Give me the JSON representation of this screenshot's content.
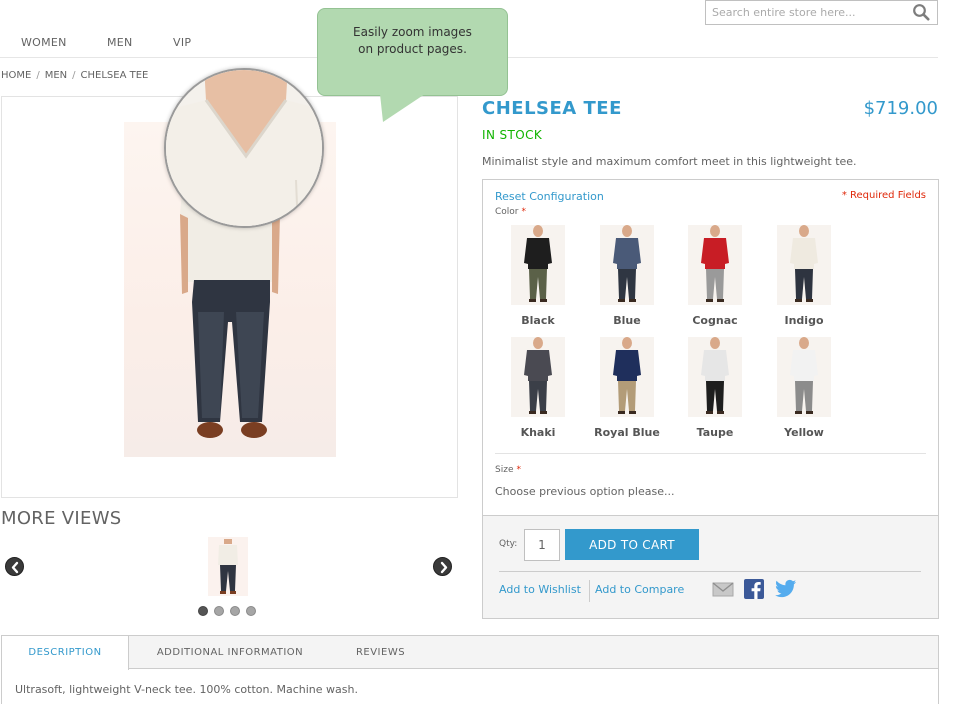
{
  "header": {
    "search_placeholder": "Search entire store here..."
  },
  "nav": {
    "items": [
      {
        "label": "WOMEN"
      },
      {
        "label": "MEN"
      },
      {
        "label": "VIP"
      }
    ]
  },
  "breadcrumb": {
    "items": [
      "HOME",
      "MEN",
      "CHELSEA TEE"
    ],
    "separator": "/"
  },
  "tooltip": {
    "text": "Easily zoom images on product pages."
  },
  "gallery": {
    "more_views_title": "MORE VIEWS",
    "dots_count": 4,
    "active_dot": 0
  },
  "product": {
    "name": "CHELSEA TEE",
    "price": "$719.00",
    "availability": "IN STOCK",
    "short_description": "Minimalist style and maximum comfort meet in this lightweight tee.",
    "reset_label": "Reset Configuration",
    "required_note": "* Required Fields",
    "color_label": "Color",
    "size_label": "Size",
    "required_star": "*",
    "size_message": "Choose previous option please...",
    "colors": [
      {
        "name": "Black",
        "shirt": "#1e1e1e",
        "pants": "#5b6148",
        "skin": "#d9a98a"
      },
      {
        "name": "Blue",
        "shirt": "#4a5a78",
        "pants": "#2f3642",
        "skin": "#d9a98a"
      },
      {
        "name": "Cognac",
        "shirt": "#c81d25",
        "pants": "#9a9a9a",
        "skin": "#d9a98a"
      },
      {
        "name": "Indigo",
        "shirt": "#efeae0",
        "pants": "#2e3440",
        "skin": "#d9a98a"
      },
      {
        "name": "Khaki",
        "shirt": "#4a4a52",
        "pants": "#3b3f48",
        "skin": "#d9a98a"
      },
      {
        "name": "Royal Blue",
        "shirt": "#1f2f5c",
        "pants": "#b39c78",
        "skin": "#d9a98a"
      },
      {
        "name": "Taupe",
        "shirt": "#e6e6e6",
        "pants": "#1e1e1e",
        "skin": "#d9a98a"
      },
      {
        "name": "Yellow",
        "shirt": "#f2f2f2",
        "pants": "#8c8c8c",
        "skin": "#d9a98a"
      }
    ]
  },
  "cart": {
    "qty_label": "Qty:",
    "qty_value": "1",
    "add_to_cart_label": "ADD TO CART",
    "wishlist_label": "Add to Wishlist",
    "compare_label": "Add to Compare"
  },
  "tabs": {
    "items": [
      {
        "label": "DESCRIPTION"
      },
      {
        "label": "ADDITIONAL INFORMATION"
      },
      {
        "label": "REVIEWS"
      }
    ],
    "active_index": 0,
    "description_text": "Ultrasoft, lightweight V-neck tee. 100% cotton. Machine wash."
  },
  "colors": {
    "accent": "#3399cc",
    "in_stock": "#11b400",
    "required": "#df280a",
    "tooltip_bg": "#b2d9b0",
    "facebook": "#3b5998",
    "twitter": "#55acee"
  }
}
